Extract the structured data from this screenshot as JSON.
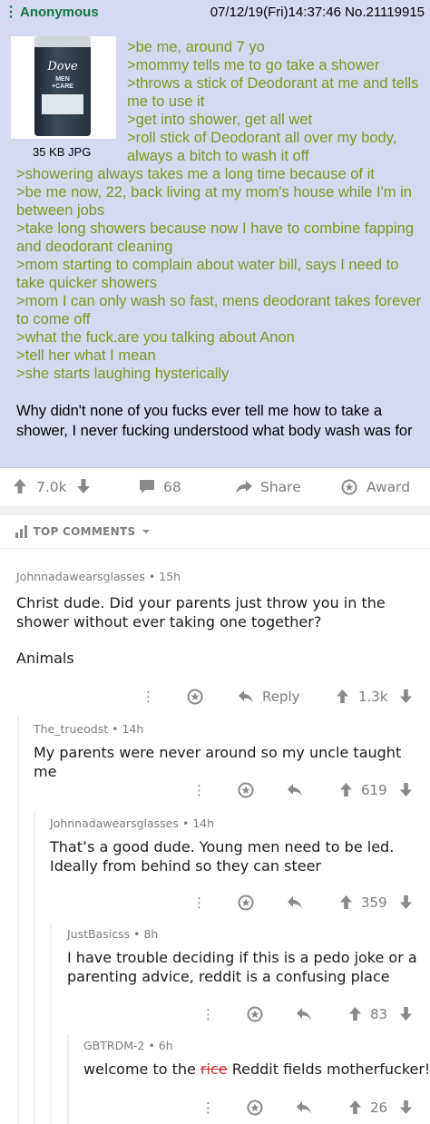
{
  "post": {
    "dots": "⋮",
    "name": "Anonymous",
    "meta": "07/12/19(Fri)14:37:46 No.21119915",
    "file_info": "35 KB JPG",
    "image": {
      "logo": "Dove",
      "line1": "MEN",
      "line2": "+CARE"
    },
    "greentext_top": [
      ">be me, around 7 yo",
      ">mommy tells me to go take a shower",
      ">throws a stick of Deodorant at me and tells me to use it",
      ">get into shower, get all wet",
      ">roll stick of Deodorant all over my body, always a bitch to wash it off"
    ],
    "greentext_bottom": [
      ">showering always takes me a long time because of it",
      ">be me now, 22, back living at my mom's house while I'm in between jobs",
      ">take long showers because now I have to combine fapping and deodorant cleaning",
      ">mom starting to complain about water bill, says I need to take quicker showers",
      ">mom I can only wash so fast, mens deodorant takes forever to come off",
      ">what the fuck.are you talking about Anon",
      ">tell her what I mean",
      ">she starts laughing hysterically"
    ],
    "closing": "Why didn't none of you fucks ever tell me how to take a shower, I never fucking understood what body wash was for"
  },
  "actions": {
    "votes": "7.0k",
    "comments": "68",
    "share": "Share",
    "award": "Award"
  },
  "top_comments_label": "TOP COMMENTS",
  "comments": [
    {
      "author": "Johnnadawearsglasses",
      "age": "15h",
      "body": [
        "Christ dude. Did your parents just throw you in the shower without ever taking one together?",
        "",
        "Animals"
      ],
      "reply": "Reply",
      "votes": "1.3k"
    },
    {
      "author": "The_trueodst",
      "age": "14h",
      "body": [
        "My parents were never around so my uncle taught me"
      ],
      "votes": "619"
    },
    {
      "author": "Johnnadawearsglasses",
      "age": "14h",
      "body": [
        "That’s a good dude. Young men need to be led. Ideally from behind so they can steer"
      ],
      "votes": "359"
    },
    {
      "author": "JustBasicss",
      "age": "8h",
      "body": [
        "I have trouble deciding if this is a pedo joke or a parenting advice, reddit is a confusing place"
      ],
      "votes": "83"
    },
    {
      "author": "GBTRDM-2",
      "age": "6h",
      "body_pre": "welcome to the ",
      "body_strike": "rice",
      "body_post": " Reddit fields motherfucker!",
      "votes": "26"
    }
  ],
  "colors": {
    "post_bg": "#d6daf0",
    "greentext": "#789922",
    "name_green": "#117743",
    "reddit_gray": "#7c7c7c"
  },
  "icons": [
    "more-icon",
    "upvote-icon",
    "downvote-icon",
    "comment-icon",
    "share-icon",
    "award-icon",
    "sort-icon",
    "chevron-down-icon",
    "reply-icon"
  ]
}
